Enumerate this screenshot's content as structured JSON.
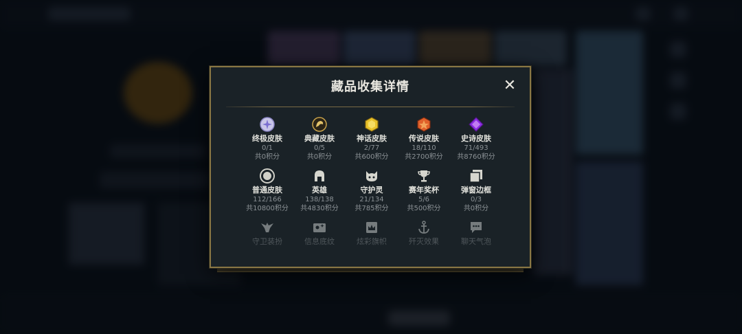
{
  "modal": {
    "title": "藏品收集详情",
    "close_label": "✕"
  },
  "collection": [
    {
      "icon": "ultimate-skin-icon",
      "name": "终极皮肤",
      "count": "0/1",
      "points": "共0积分"
    },
    {
      "icon": "prestige-skin-icon",
      "name": "典藏皮肤",
      "count": "0/5",
      "points": "共0积分"
    },
    {
      "icon": "mythic-skin-icon",
      "name": "神话皮肤",
      "count": "2/77",
      "points": "共600积分"
    },
    {
      "icon": "legendary-skin-icon",
      "name": "传说皮肤",
      "count": "18/110",
      "points": "共2700积分"
    },
    {
      "icon": "epic-skin-icon",
      "name": "史诗皮肤",
      "count": "71/493",
      "points": "共8760积分"
    },
    {
      "icon": "standard-skin-icon",
      "name": "普通皮肤",
      "count": "112/166",
      "points": "共10800积分"
    },
    {
      "icon": "champion-helmet-icon",
      "name": "英雄",
      "count": "138/138",
      "points": "共4830积分"
    },
    {
      "icon": "ward-guardian-icon",
      "name": "守护灵",
      "count": "21/134",
      "points": "共785积分"
    },
    {
      "icon": "trophy-icon",
      "name": "赛年奖杯",
      "count": "5/6",
      "points": "共500积分"
    },
    {
      "icon": "border-frame-icon",
      "name": "弹窗边框",
      "count": "0/3",
      "points": "共0积分"
    },
    {
      "icon": "guardian-emblem-icon",
      "name": "守卫装扮",
      "count": "",
      "points": ""
    },
    {
      "icon": "profile-card-icon",
      "name": "信息底纹",
      "count": "",
      "points": ""
    },
    {
      "icon": "crown-banner-icon",
      "name": "炫彩旗帜",
      "count": "",
      "points": ""
    },
    {
      "icon": "anchor-icon",
      "name": "歼灭效果",
      "count": "",
      "points": ""
    },
    {
      "icon": "chat-bubble-icon",
      "name": "聊天气泡",
      "count": "",
      "points": ""
    }
  ],
  "colors": {
    "modal_border": "#8a7744",
    "modal_bg": "#1a2227",
    "gold": "#c8a24a",
    "epic_purple": "#8a2be2",
    "legendary_orange": "#e0602a",
    "mythic_yellow": "#e8c22a"
  }
}
